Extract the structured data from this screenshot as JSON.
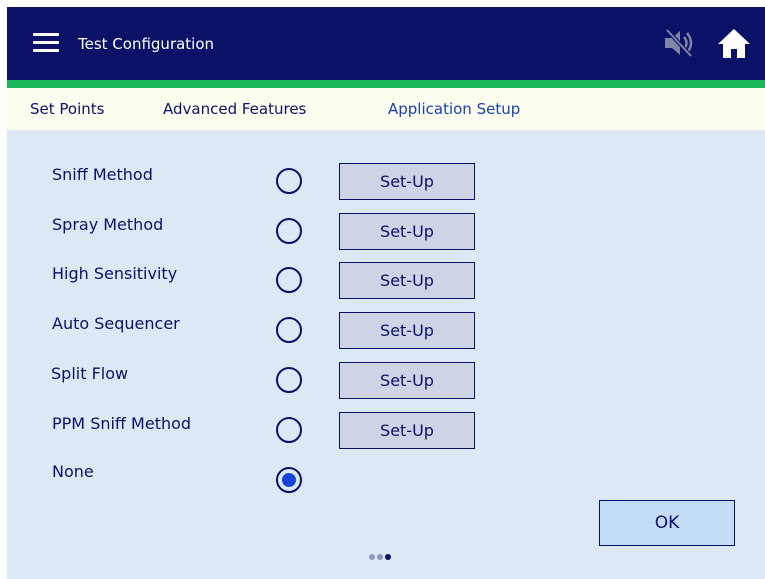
{
  "header": {
    "title": "Test Configuration",
    "menu_icon": "hamburger-menu-icon",
    "mute_icon": "speaker-muted-icon",
    "home_icon": "home-icon",
    "bg_color": "#0c1168",
    "accent_color": "#1bb85b"
  },
  "tabs": [
    {
      "label": "Set Points",
      "active": false
    },
    {
      "label": "Advanced Features",
      "active": false
    },
    {
      "label": "Application Setup",
      "active": true
    }
  ],
  "options": [
    {
      "label": "Sniff Method",
      "selected": false,
      "setup_label": "Set-Up"
    },
    {
      "label": "Spray Method",
      "selected": false,
      "setup_label": "Set-Up"
    },
    {
      "label": "High Sensitivity",
      "selected": false,
      "setup_label": "Set-Up"
    },
    {
      "label": "Auto Sequencer",
      "selected": false,
      "setup_label": "Set-Up"
    },
    {
      "label": "Split Flow",
      "selected": false,
      "setup_label": "Set-Up"
    },
    {
      "label": "PPM Sniff Method",
      "selected": false,
      "setup_label": "Set-Up"
    },
    {
      "label": "None",
      "selected": true
    }
  ],
  "footer": {
    "ok_label": "OK",
    "page_count": 3,
    "current_page": 3
  }
}
